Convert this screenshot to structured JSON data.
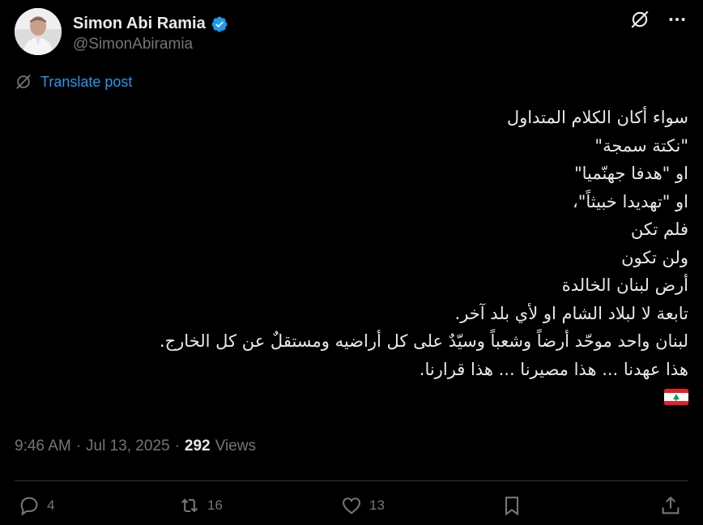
{
  "author": {
    "name": "Simon Abi Ramia",
    "handle": "@SimonAbiramia"
  },
  "translate_label": "Translate post",
  "tweet_lines": [
    "سواء أكان الكلام المتداول",
    "\"نكتة سمجة\"",
    "او \"هدفا جهنّميا\"",
    "او \"تهديدا خبيثاً\"،",
    "فلم تكن",
    "ولن تكون",
    "أرض لبنان الخالدة",
    "تابعة لا لبلاد الشام او لأي بلد آخر.",
    "لبنان واحد موحّد أرضاً وشعباً وسيّدٌ على كل أراضيه ومستقلٌ عن كل الخارج.",
    "هذا عهدنا ... هذا مصيرنا ... هذا قرارنا."
  ],
  "meta": {
    "time": "9:46 AM",
    "sep1": "·",
    "date": "Jul 13, 2025",
    "sep2": "·",
    "views_count": "292",
    "views_label": "Views"
  },
  "actions": {
    "replies": "4",
    "reposts": "16",
    "likes": "13"
  },
  "icons": {
    "verified": "verified-badge-icon",
    "grok": "grok-icon",
    "more": "more-icon",
    "translate": "translate-icon",
    "reply": "reply-icon",
    "repost": "repost-icon",
    "like": "like-icon",
    "bookmark": "bookmark-icon",
    "share": "share-icon"
  },
  "colors": {
    "background": "#000000",
    "text": "#e7e9ea",
    "secondary": "#71767b",
    "accent": "#1d9bf0",
    "divider": "#2f3336"
  }
}
